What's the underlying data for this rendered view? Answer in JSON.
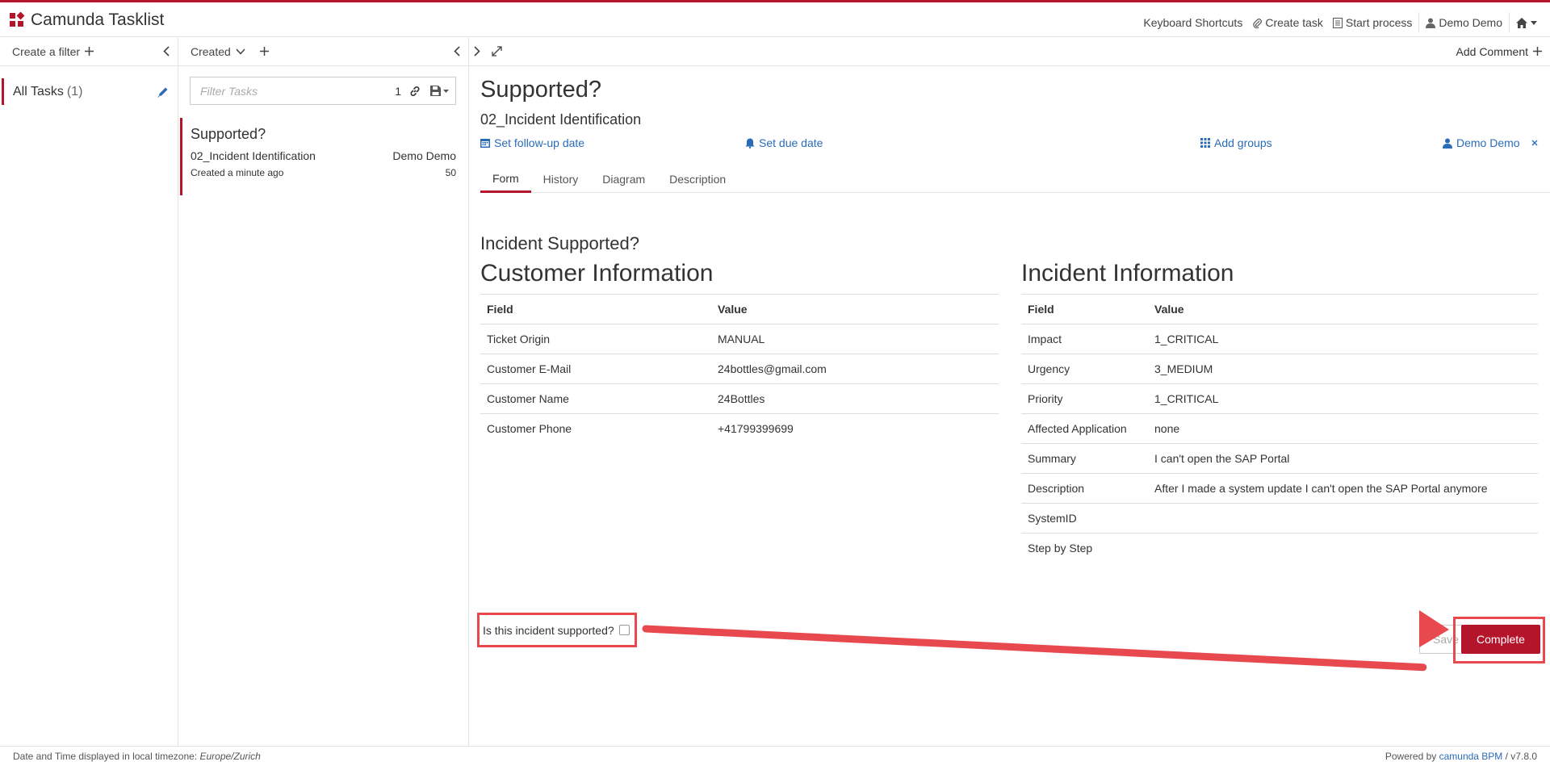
{
  "app": {
    "title": "Camunda Tasklist",
    "accent_color": "#b5152b",
    "link_color": "#2a6bb8",
    "logo_icon": "camunda-logo-icon"
  },
  "header": {
    "nav": [
      {
        "label": "Keyboard Shortcuts",
        "icon": ""
      },
      {
        "label": "Create task",
        "icon": "paperclip-icon"
      },
      {
        "label": "Start process",
        "icon": "list-icon"
      },
      {
        "label": "Demo Demo",
        "icon": "user-icon"
      }
    ],
    "home_icon": "home-icon"
  },
  "filters": {
    "create_label": "Create a filter",
    "items": [
      {
        "label": "All Tasks",
        "count": "(1)"
      }
    ]
  },
  "list": {
    "sort_label": "Created",
    "search_placeholder": "Filter Tasks",
    "search_count": "1",
    "tasks": [
      {
        "title": "Supported?",
        "process": "02_Incident Identification",
        "assignee": "Demo Demo",
        "created": "Created a minute ago",
        "priority": "50"
      }
    ]
  },
  "task": {
    "add_comment_label": "Add Comment",
    "title": "Supported?",
    "subtitle": "02_Incident Identification",
    "follow_up_label": "Set follow-up date",
    "due_date_label": "Set due date",
    "groups_label": "Add groups",
    "assignee_label": "Demo Demo",
    "tabs": [
      "Form",
      "History",
      "Diagram",
      "Description"
    ],
    "active_tab": "Form"
  },
  "form": {
    "heading": "Incident Supported?",
    "customer": {
      "title": "Customer Information",
      "headers": [
        "Field",
        "Value"
      ],
      "rows": [
        [
          "Ticket Origin",
          "MANUAL"
        ],
        [
          "Customer E-Mail",
          "24bottles@gmail.com"
        ],
        [
          "Customer Name",
          "24Bottles"
        ],
        [
          "Customer Phone",
          "+41799399699"
        ]
      ]
    },
    "incident": {
      "title": "Incident Information",
      "headers": [
        "Field",
        "Value"
      ],
      "rows": [
        [
          "Impact",
          "1_CRITICAL"
        ],
        [
          "Urgency",
          "3_MEDIUM"
        ],
        [
          "Priority",
          "1_CRITICAL"
        ],
        [
          "Affected Application",
          "none"
        ],
        [
          "Summary",
          "I can't open the SAP Portal"
        ],
        [
          "Description",
          "After I made a system update I can't open the SAP Portal anymore"
        ],
        [
          "SystemID",
          ""
        ],
        [
          "Step by Step",
          ""
        ]
      ]
    },
    "checkbox_label": "Is this incident supported?",
    "checkbox_checked": false,
    "save_label": "Save",
    "complete_label": "Complete",
    "annotation_color": "#e8494f"
  },
  "footer": {
    "timezone_prefix": "Date and Time displayed in local timezone:",
    "timezone": "Europe/Zurich",
    "powered_prefix": "Powered by",
    "powered_brand": "camunda BPM",
    "version": "/ v7.8.0"
  }
}
